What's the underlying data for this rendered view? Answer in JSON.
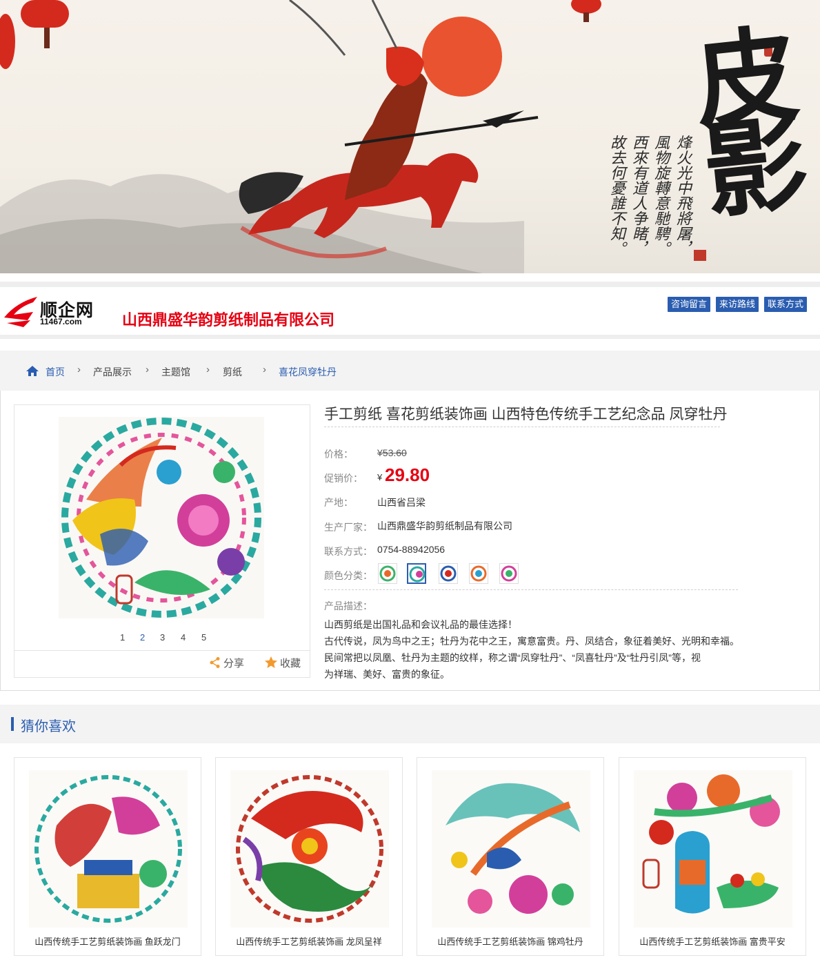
{
  "banner": {
    "title": "皮影",
    "poem_lines": [
      "烽火光中飛將屠，",
      "風物旋轉意馳騁。",
      "西來有道人争睹，",
      "故去何憂誰不知。"
    ]
  },
  "header": {
    "logo_name": "顺企网",
    "logo_url": "11467.com",
    "company": "山西鼎盛华韵剪纸制品有限公司",
    "buttons": [
      "咨询留言",
      "来访路线",
      "联系方式"
    ]
  },
  "breadcrumb": [
    "首页",
    "产品展示",
    "主题馆",
    "剪纸",
    "喜花凤穿牡丹"
  ],
  "product": {
    "title": "手工剪纸  喜花剪纸装饰画 山西特色传统手工艺纪念品 凤穿牡丹",
    "price_label": "价格：",
    "price": "¥53.60",
    "promo_label": "促销价：",
    "promo_currency": "¥",
    "promo_price": "29.80",
    "origin_label": "产地：",
    "origin": "山西省吕梁",
    "maker_label": "生产厂家：",
    "maker": "山西鼎盛华韵剪纸制品有限公司",
    "contact_label": "联系方式：",
    "contact": "0754-88942056",
    "color_label": "颜色分类：",
    "desc_label": "产品描述：",
    "desc": [
      "山西剪纸是出国礼品和会议礼品的最佳选择！",
      "古代传说，凤为鸟中之王；牡丹为花中之王，寓意富贵。丹、凤结合，象征着美好、光明和幸福。",
      "民间常把以凤凰、牡丹为主题的纹样，称之谓“凤穿牡丹”、“凤喜牡丹”及“牡丹引凤”等，视",
      "为祥瑞、美好、富贵的象征。"
    ],
    "pages": [
      "1",
      "2",
      "3",
      "4",
      "5"
    ],
    "active_page": "2",
    "share_label": "分享",
    "fav_label": "收藏"
  },
  "guess": {
    "title": "猜你喜欢",
    "items": [
      "山西传统手工艺剪纸装饰画 鱼跃龙门",
      "山西传统手工艺剪纸装饰画 龙凤呈祥",
      "山西传统手工艺剪纸装饰画 锦鸡牡丹",
      "山西传统手工艺剪纸装饰画 富贵平安"
    ]
  },
  "colors": {
    "brand_blue": "#2a5db0",
    "price_red": "#e60012"
  }
}
